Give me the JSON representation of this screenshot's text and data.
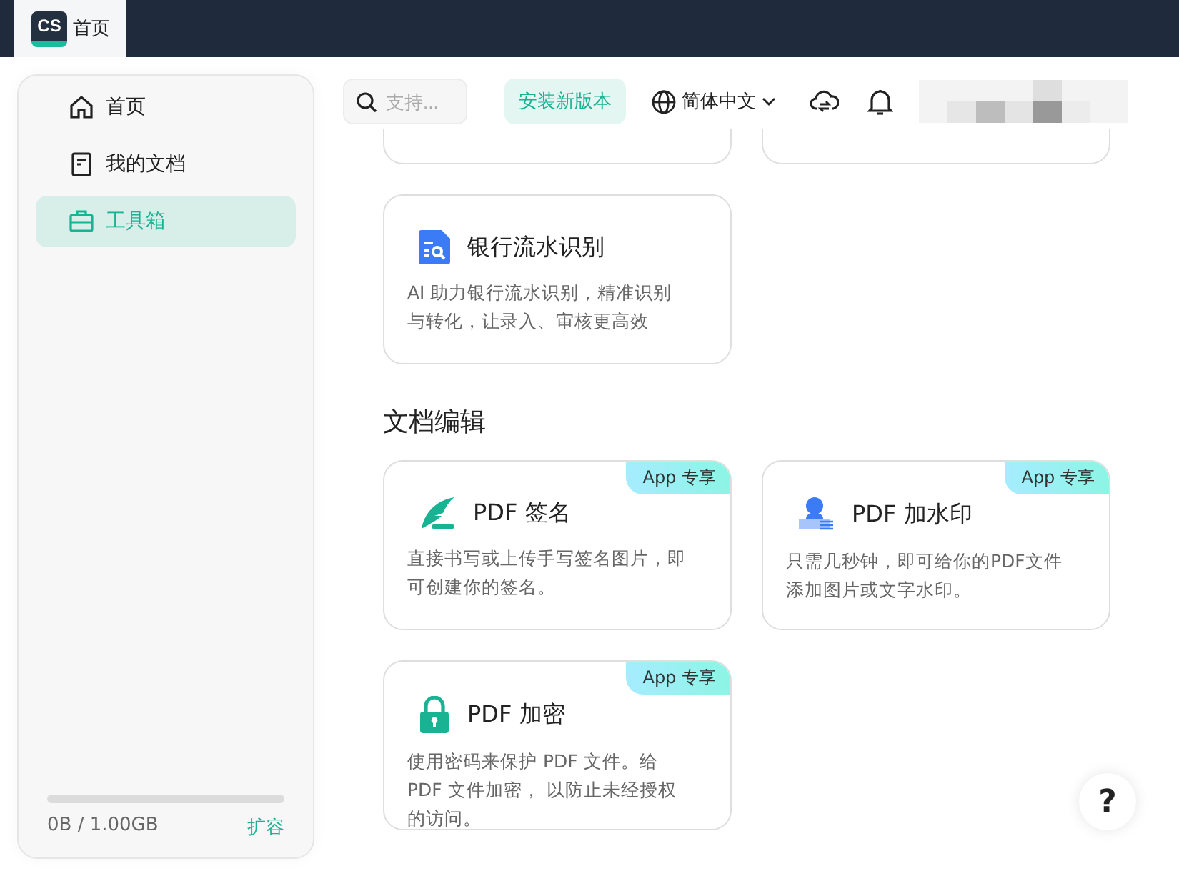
{
  "top_bar": {
    "logo": "CS",
    "tab": {
      "label": "首页",
      "selected": true
    }
  },
  "sidebar": {
    "items": [
      {
        "label": "首页",
        "selected": false
      },
      {
        "label": "我的文档",
        "selected": false
      },
      {
        "label": "工具箱",
        "selected": true
      }
    ],
    "storage": {
      "level": 0,
      "text": "0B / 1.00GB",
      "action": "扩容"
    }
  },
  "header": {
    "search": {
      "placeholder": "支持..."
    },
    "install_button": "安装新版本",
    "language": "简体中文"
  },
  "sections": [
    {
      "cards": [
        {
          "kind": "partial"
        },
        {
          "kind": "partial"
        },
        {
          "kind": "bank",
          "title": "银行流水识别",
          "description": "AI 助力银行流水识别，精准识别与转化，让录入、审核更高效"
        }
      ]
    },
    {
      "title": "文档编辑",
      "cards": [
        {
          "kind": "sign",
          "title": "PDF 签名",
          "badge": "App 专享",
          "description": "直接书写或上传手写签名图片，即可创建你的签名。"
        },
        {
          "kind": "watermark",
          "title": "PDF 加水印",
          "badge": "App 专享",
          "description": "只需几秒钟，即可给你的PDF文件添加图片或文字水印。"
        },
        {
          "kind": "lock",
          "title": "PDF 加密",
          "badge": "App 专享",
          "description": "使用密码来保护 PDF 文件。给PDF 文件加密， 以防止未经授权的访问。"
        }
      ]
    }
  ],
  "help_button": "?"
}
